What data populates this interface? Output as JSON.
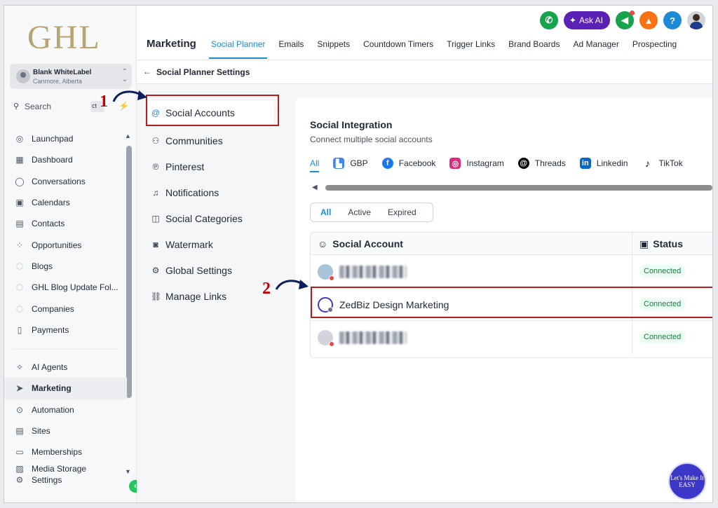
{
  "app": {
    "logo": "GHL"
  },
  "account": {
    "name": "Blank WhiteLabel",
    "location": "Canmore, Alberta"
  },
  "search": {
    "label": "Search",
    "shortcut": "ct"
  },
  "sidebar": {
    "items": [
      {
        "label": "Launchpad",
        "icon": "launchpad-icon"
      },
      {
        "label": "Dashboard",
        "icon": "dashboard-icon"
      },
      {
        "label": "Conversations",
        "icon": "chat-icon"
      },
      {
        "label": "Calendars",
        "icon": "calendar-icon"
      },
      {
        "label": "Contacts",
        "icon": "contacts-icon"
      },
      {
        "label": "Opportunities",
        "icon": "opportunities-icon"
      },
      {
        "label": "Blogs",
        "icon": "blog-icon"
      },
      {
        "label": "GHL Blog Update Fol...",
        "icon": "blog-icon"
      },
      {
        "label": "Companies",
        "icon": "companies-icon"
      },
      {
        "label": "Payments",
        "icon": "payments-icon"
      }
    ],
    "items2": [
      {
        "label": "AI Agents",
        "icon": "sparkle-icon"
      },
      {
        "label": "Marketing",
        "icon": "send-icon"
      },
      {
        "label": "Automation",
        "icon": "automation-icon"
      },
      {
        "label": "Sites",
        "icon": "sites-icon"
      },
      {
        "label": "Memberships",
        "icon": "memberships-icon"
      },
      {
        "label": "Media Storage",
        "icon": "media-icon"
      }
    ],
    "settings_label": "Settings"
  },
  "header": {
    "section": "Marketing",
    "ask_ai": "Ask AI",
    "tabs": [
      "Social Planner",
      "Emails",
      "Snippets",
      "Countdown Timers",
      "Trigger Links",
      "Brand Boards",
      "Ad Manager",
      "Prospecting"
    ],
    "colors": {
      "phone": "#16a34a",
      "ai": "#5b21b6",
      "announce": "#16a34a",
      "bell": "#f97316",
      "help": "#1d8ad6"
    }
  },
  "subheader": {
    "title": "Social Planner Settings"
  },
  "settings_menu": [
    "Social Accounts",
    "Communities",
    "Pinterest",
    "Notifications",
    "Social Categories",
    "Watermark",
    "Global Settings",
    "Manage Links"
  ],
  "panel": {
    "title": "Social Integration",
    "subtitle": "Connect multiple social accounts",
    "platform_tabs": [
      "All",
      "GBP",
      "Facebook",
      "Instagram",
      "Threads",
      "Linkedin",
      "TikTok"
    ],
    "filters": [
      "All",
      "Active",
      "Expired"
    ],
    "table": {
      "col_account": "Social Account",
      "col_status": "Status",
      "rows": [
        {
          "account": "",
          "status": "Connected"
        },
        {
          "account": "ZedBiz Design Marketing",
          "status": "Connected"
        },
        {
          "account": "",
          "status": "Connected"
        }
      ]
    }
  },
  "annotations": {
    "step1": "1",
    "step2": "2"
  },
  "watermark": "Let's Make It EASY"
}
